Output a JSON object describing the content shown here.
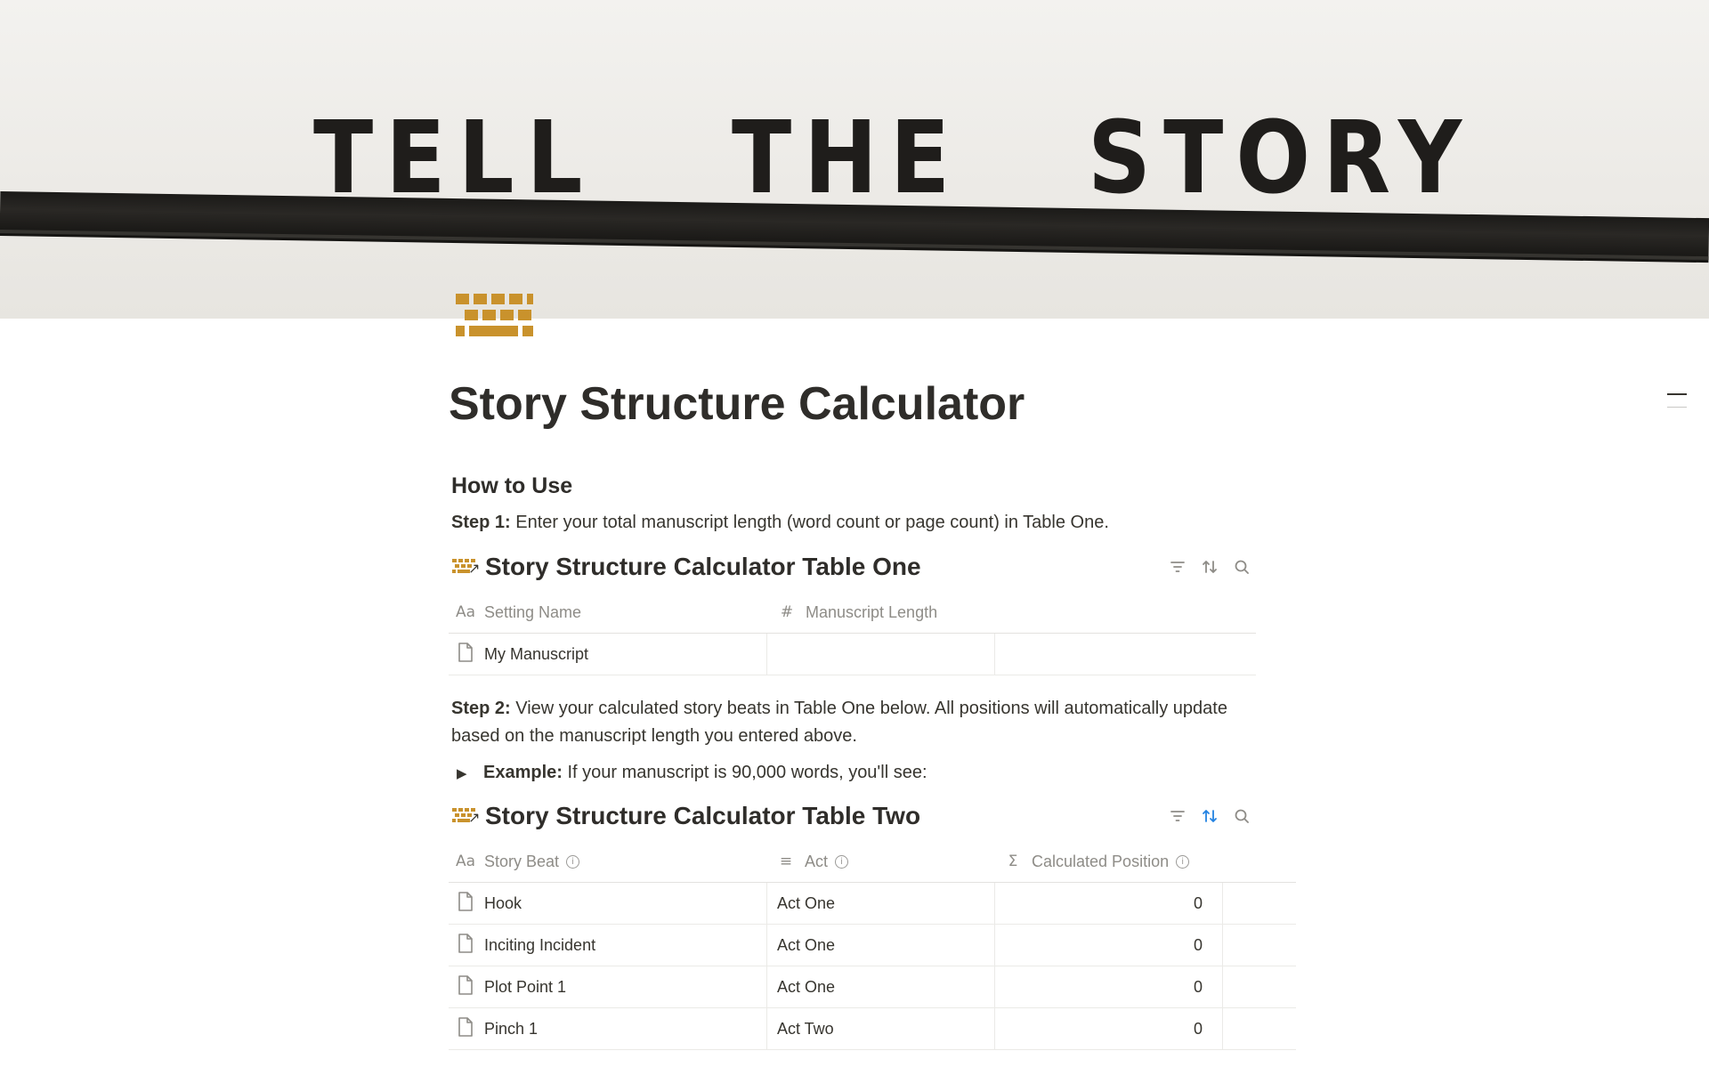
{
  "cover": {
    "words": [
      "TELL",
      "THE",
      "STORY"
    ]
  },
  "page": {
    "title": "Story Structure Calculator"
  },
  "how_to_use": {
    "heading": "How to Use",
    "step1_label": "Step 1:",
    "step1_text": " Enter your total manuscript length (word count or page count) in Table One.",
    "step2_label": "Step 2:",
    "step2_text": " View your calculated story beats in Table One below. All positions will automatically update",
    "step2_text_line2": "based on the manuscript length you entered above.",
    "toggle_label": "Example:",
    "toggle_text": " If your manuscript is 90,000 words, you'll see:"
  },
  "table_one": {
    "title": "Story Structure Calculator Table One",
    "columns": [
      {
        "label": "Setting Name",
        "icon": "title-icon"
      },
      {
        "label": "Manuscript Length",
        "icon": "number-icon"
      }
    ],
    "rows": [
      {
        "name": "My Manuscript",
        "length": ""
      }
    ]
  },
  "table_two": {
    "title": "Story Structure Calculator Table Two",
    "columns": [
      {
        "label": "Story Beat",
        "icon": "title-icon"
      },
      {
        "label": "Act",
        "icon": "text-icon"
      },
      {
        "label": "Calculated Position",
        "icon": "sigma-icon"
      }
    ],
    "rows": [
      {
        "beat": "Hook",
        "act": "Act One",
        "position": "0"
      },
      {
        "beat": "Inciting Incident",
        "act": "Act One",
        "position": "0"
      },
      {
        "beat": "Plot Point 1",
        "act": "Act One",
        "position": "0"
      },
      {
        "beat": "Pinch 1",
        "act": "Act Two",
        "position": "0"
      }
    ]
  },
  "colors": {
    "accent": "#c9922c",
    "sort_active": "#2383e2",
    "text": "#37352f",
    "muted": "#8e8c87"
  },
  "icons": [
    "hamburger-icon",
    "filter-icon",
    "sort-icon",
    "search-icon",
    "page-icon",
    "database-icon",
    "toggle-triangle-icon"
  ]
}
